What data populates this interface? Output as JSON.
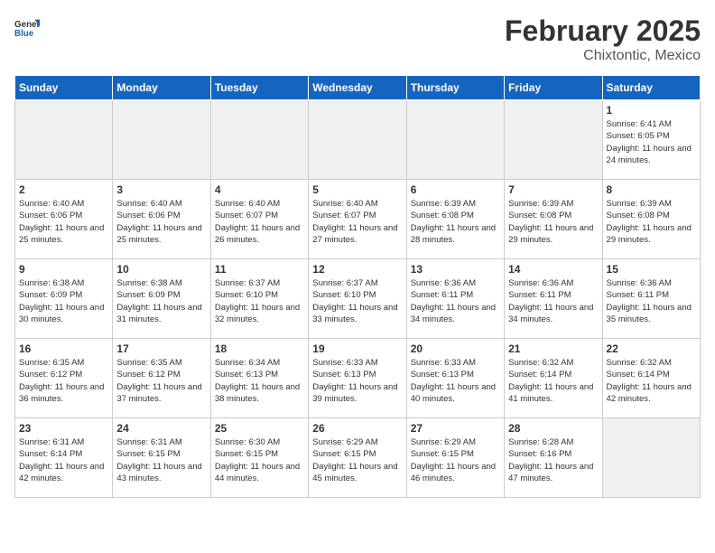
{
  "header": {
    "logo_general": "General",
    "logo_blue": "Blue",
    "month_year": "February 2025",
    "location": "Chixtontic, Mexico"
  },
  "weekdays": [
    "Sunday",
    "Monday",
    "Tuesday",
    "Wednesday",
    "Thursday",
    "Friday",
    "Saturday"
  ],
  "weeks": [
    [
      {
        "day": "",
        "empty": true
      },
      {
        "day": "",
        "empty": true
      },
      {
        "day": "",
        "empty": true
      },
      {
        "day": "",
        "empty": true
      },
      {
        "day": "",
        "empty": true
      },
      {
        "day": "",
        "empty": true
      },
      {
        "day": "1",
        "sunrise": "6:41 AM",
        "sunset": "6:05 PM",
        "daylight": "11 hours and 24 minutes."
      }
    ],
    [
      {
        "day": "2",
        "sunrise": "6:40 AM",
        "sunset": "6:06 PM",
        "daylight": "11 hours and 25 minutes."
      },
      {
        "day": "3",
        "sunrise": "6:40 AM",
        "sunset": "6:06 PM",
        "daylight": "11 hours and 25 minutes."
      },
      {
        "day": "4",
        "sunrise": "6:40 AM",
        "sunset": "6:07 PM",
        "daylight": "11 hours and 26 minutes."
      },
      {
        "day": "5",
        "sunrise": "6:40 AM",
        "sunset": "6:07 PM",
        "daylight": "11 hours and 27 minutes."
      },
      {
        "day": "6",
        "sunrise": "6:39 AM",
        "sunset": "6:08 PM",
        "daylight": "11 hours and 28 minutes."
      },
      {
        "day": "7",
        "sunrise": "6:39 AM",
        "sunset": "6:08 PM",
        "daylight": "11 hours and 29 minutes."
      },
      {
        "day": "8",
        "sunrise": "6:39 AM",
        "sunset": "6:08 PM",
        "daylight": "11 hours and 29 minutes."
      }
    ],
    [
      {
        "day": "9",
        "sunrise": "6:38 AM",
        "sunset": "6:09 PM",
        "daylight": "11 hours and 30 minutes."
      },
      {
        "day": "10",
        "sunrise": "6:38 AM",
        "sunset": "6:09 PM",
        "daylight": "11 hours and 31 minutes."
      },
      {
        "day": "11",
        "sunrise": "6:37 AM",
        "sunset": "6:10 PM",
        "daylight": "11 hours and 32 minutes."
      },
      {
        "day": "12",
        "sunrise": "6:37 AM",
        "sunset": "6:10 PM",
        "daylight": "11 hours and 33 minutes."
      },
      {
        "day": "13",
        "sunrise": "6:36 AM",
        "sunset": "6:11 PM",
        "daylight": "11 hours and 34 minutes."
      },
      {
        "day": "14",
        "sunrise": "6:36 AM",
        "sunset": "6:11 PM",
        "daylight": "11 hours and 34 minutes."
      },
      {
        "day": "15",
        "sunrise": "6:36 AM",
        "sunset": "6:11 PM",
        "daylight": "11 hours and 35 minutes."
      }
    ],
    [
      {
        "day": "16",
        "sunrise": "6:35 AM",
        "sunset": "6:12 PM",
        "daylight": "11 hours and 36 minutes."
      },
      {
        "day": "17",
        "sunrise": "6:35 AM",
        "sunset": "6:12 PM",
        "daylight": "11 hours and 37 minutes."
      },
      {
        "day": "18",
        "sunrise": "6:34 AM",
        "sunset": "6:13 PM",
        "daylight": "11 hours and 38 minutes."
      },
      {
        "day": "19",
        "sunrise": "6:33 AM",
        "sunset": "6:13 PM",
        "daylight": "11 hours and 39 minutes."
      },
      {
        "day": "20",
        "sunrise": "6:33 AM",
        "sunset": "6:13 PM",
        "daylight": "11 hours and 40 minutes."
      },
      {
        "day": "21",
        "sunrise": "6:32 AM",
        "sunset": "6:14 PM",
        "daylight": "11 hours and 41 minutes."
      },
      {
        "day": "22",
        "sunrise": "6:32 AM",
        "sunset": "6:14 PM",
        "daylight": "11 hours and 42 minutes."
      }
    ],
    [
      {
        "day": "23",
        "sunrise": "6:31 AM",
        "sunset": "6:14 PM",
        "daylight": "11 hours and 42 minutes."
      },
      {
        "day": "24",
        "sunrise": "6:31 AM",
        "sunset": "6:15 PM",
        "daylight": "11 hours and 43 minutes."
      },
      {
        "day": "25",
        "sunrise": "6:30 AM",
        "sunset": "6:15 PM",
        "daylight": "11 hours and 44 minutes."
      },
      {
        "day": "26",
        "sunrise": "6:29 AM",
        "sunset": "6:15 PM",
        "daylight": "11 hours and 45 minutes."
      },
      {
        "day": "27",
        "sunrise": "6:29 AM",
        "sunset": "6:15 PM",
        "daylight": "11 hours and 46 minutes."
      },
      {
        "day": "28",
        "sunrise": "6:28 AM",
        "sunset": "6:16 PM",
        "daylight": "11 hours and 47 minutes."
      },
      {
        "day": "",
        "empty": true
      }
    ]
  ],
  "labels": {
    "sunrise": "Sunrise:",
    "sunset": "Sunset:",
    "daylight": "Daylight:"
  }
}
